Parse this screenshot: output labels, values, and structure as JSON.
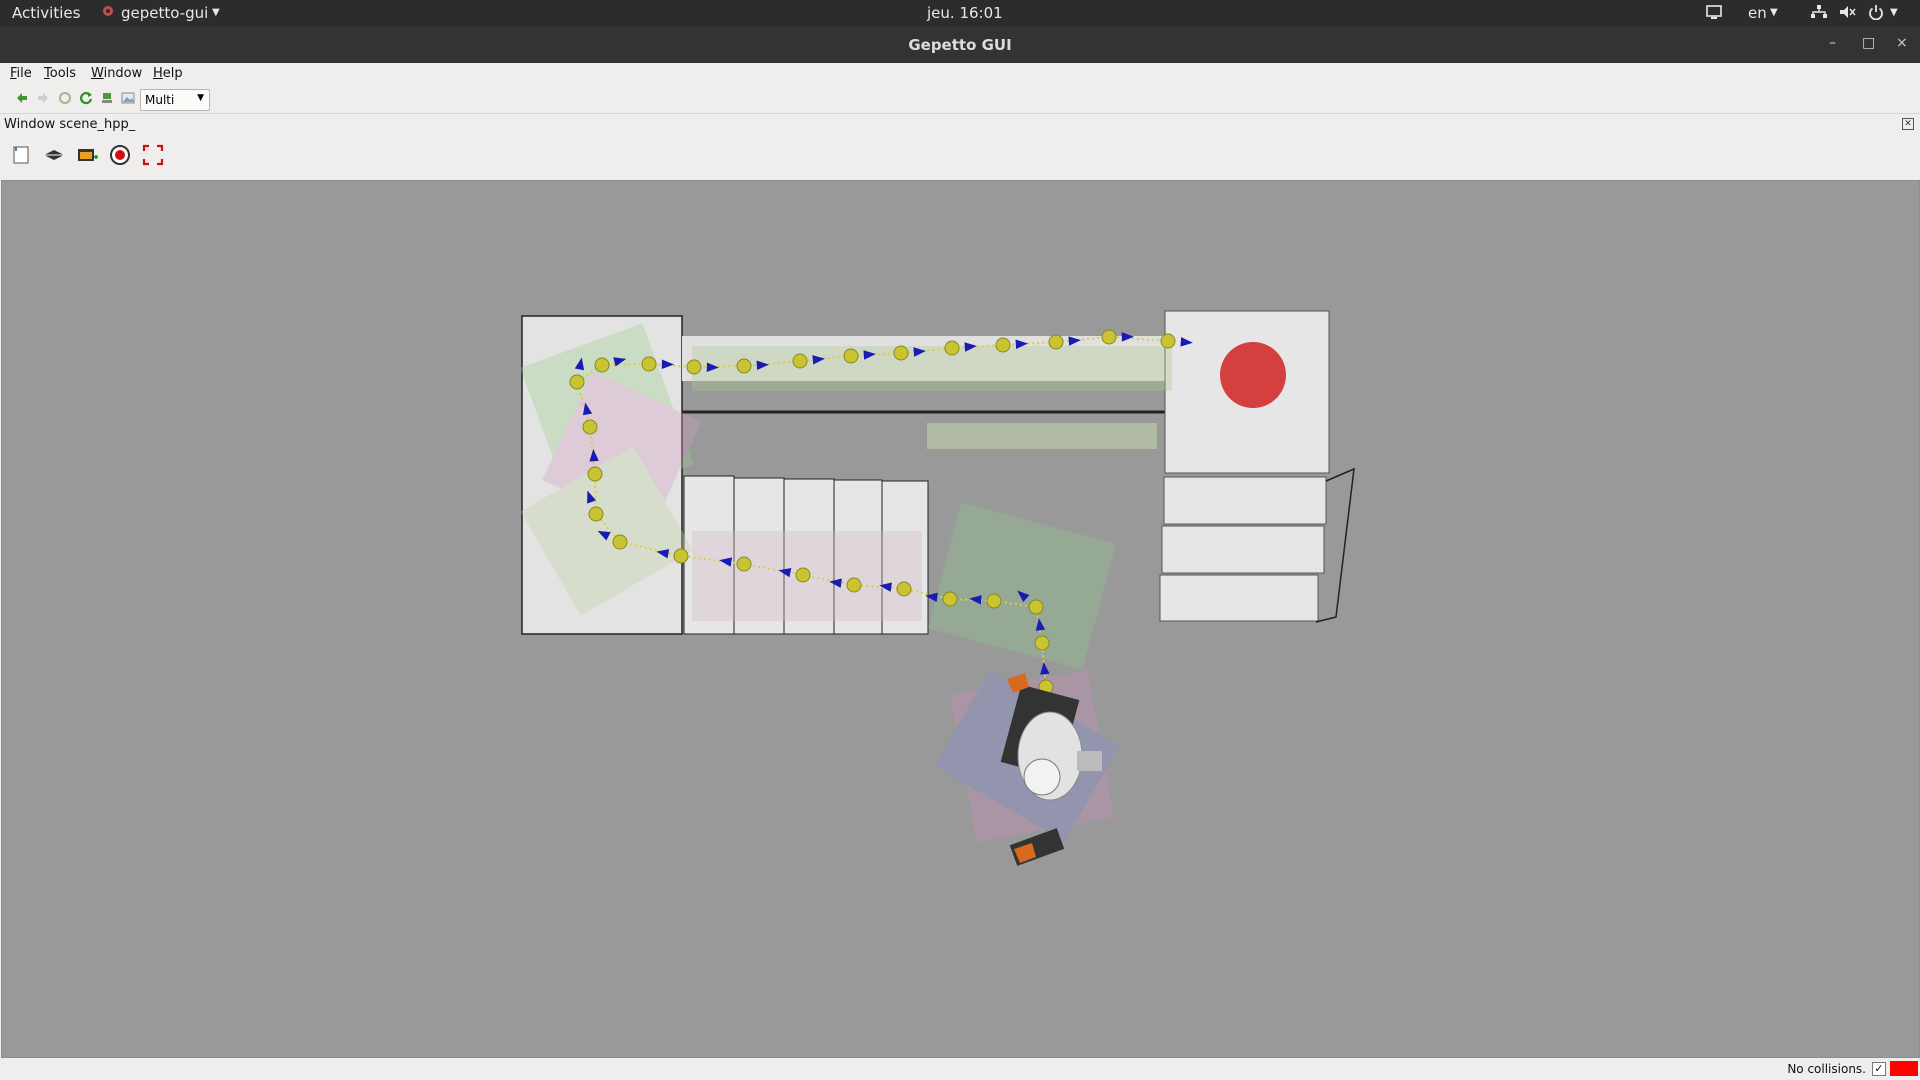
{
  "topbar": {
    "activities": "Activities",
    "app_menu": "gepetto-gui",
    "clock": "jeu. 16:01",
    "language": "en"
  },
  "window": {
    "title": "Gepetto GUI",
    "minimize": "–",
    "maximize": "□",
    "close": "×"
  },
  "menubar": {
    "items": [
      {
        "label": "File",
        "accel": "F",
        "rest": "ile"
      },
      {
        "label": "Tools",
        "accel": "T",
        "rest": "ools"
      },
      {
        "label": "Window",
        "accel": "W",
        "rest": "indow"
      },
      {
        "label": "Help",
        "accel": "H",
        "rest": "elp"
      }
    ]
  },
  "toolbar": {
    "mode_select_value": "Multi",
    "icons": [
      "back-icon",
      "forward-icon",
      "refresh-icon",
      "reload-icon",
      "download-icon",
      "image-icon"
    ]
  },
  "dock": {
    "title": "Window scene_hpp_",
    "tools": [
      "new-window-icon",
      "plane-icon",
      "screenshot-icon",
      "record-icon",
      "fullscreen-icon"
    ]
  },
  "status": {
    "collision_text": "No collisions.",
    "checkbox": "✓",
    "collision_color": "#ff0000"
  },
  "colors": {
    "viewer_background": "#999999",
    "path_node": "#c8c432",
    "arrow": "#1a1ab4",
    "goal": "#d44040"
  }
}
